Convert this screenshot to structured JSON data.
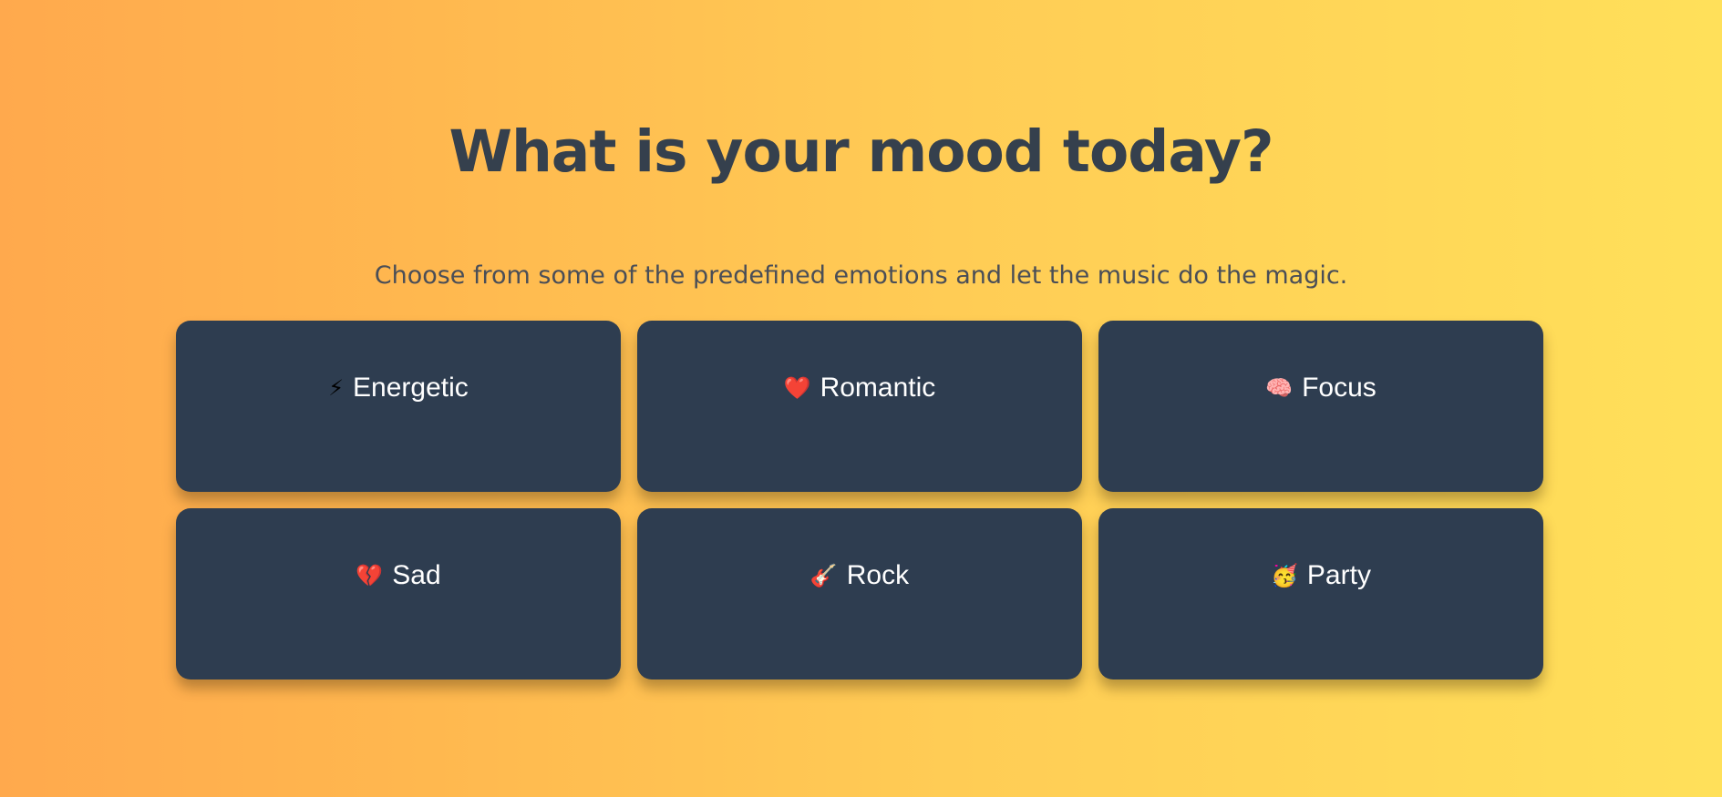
{
  "header": {
    "title": "What is your mood today?",
    "subtitle": "Choose from some of the predefined emotions and let the music do the magic."
  },
  "moods": [
    {
      "icon": "lightning-icon",
      "emoji": "⚡",
      "label": "Energetic"
    },
    {
      "icon": "heart-icon",
      "emoji": "❤️",
      "label": "Romantic"
    },
    {
      "icon": "brain-icon",
      "emoji": "🧠",
      "label": "Focus"
    },
    {
      "icon": "broken-heart-icon",
      "emoji": "💔",
      "label": "Sad"
    },
    {
      "icon": "guitar-icon",
      "emoji": "🎸",
      "label": "Rock"
    },
    {
      "icon": "party-face-icon",
      "emoji": "🥳",
      "label": "Party"
    }
  ],
  "colors": {
    "card": "#2e3d50",
    "title": "#35404d",
    "gradient_start": "#ffa94d",
    "gradient_end": "#ffe05a"
  }
}
